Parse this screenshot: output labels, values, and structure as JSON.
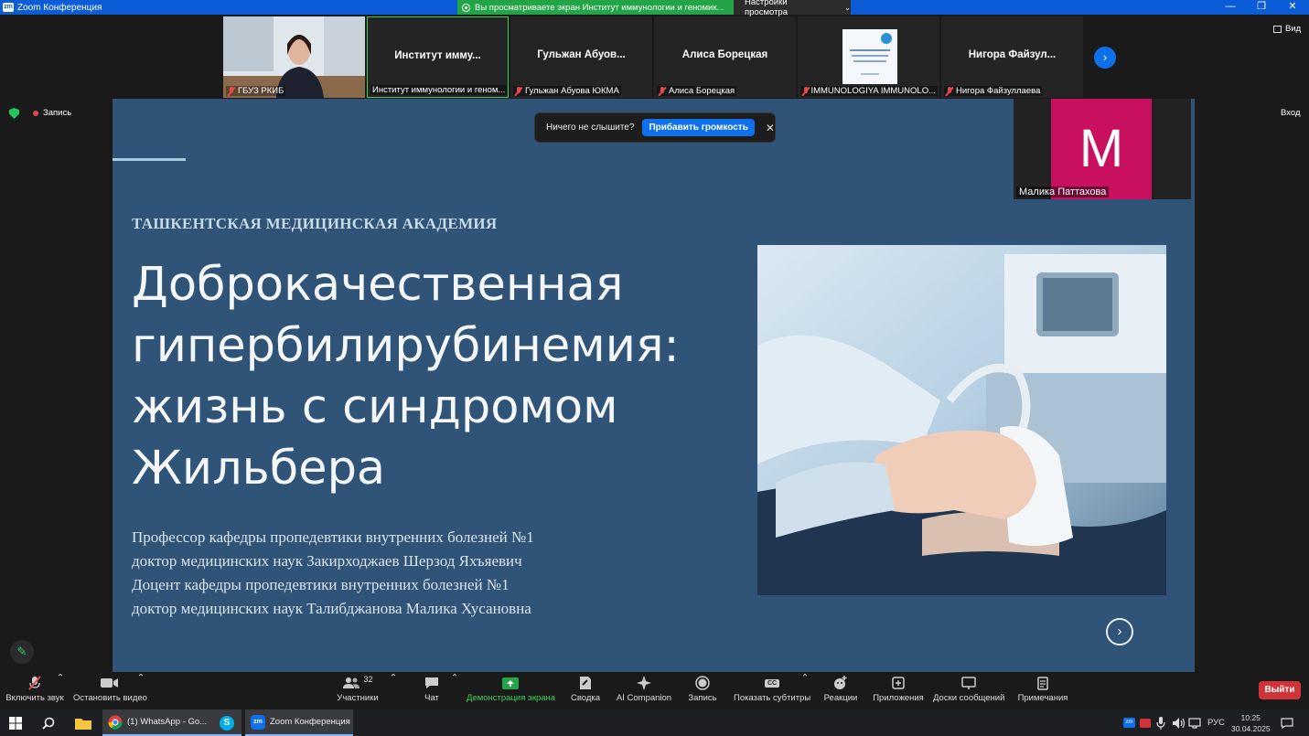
{
  "window": {
    "app_icon": "zm",
    "title": "Zoom Конференция",
    "share_banner": "Вы просматриваете экран Институт иммунологии и геномик...",
    "view_settings": "Настройки просмотра"
  },
  "strip": {
    "tiles": [
      {
        "name": "",
        "caption": "ГБУЗ РКИБ",
        "type": "video",
        "muted": true
      },
      {
        "name": "Институт  имму...",
        "caption": "Институт иммунологии и геном...",
        "muted": false
      },
      {
        "name": "Гульжан  Абуов...",
        "caption": "Гульжан Абуова ЮКМА",
        "muted": true
      },
      {
        "name": "Алиса Борецкая",
        "caption": "Алиса Борецкая",
        "muted": true
      },
      {
        "name": "",
        "caption": "IMMUNOLOGIYA IMMUNOLO...",
        "type": "logo",
        "muted": true
      },
      {
        "name": "Нигора  Файзул...",
        "caption": "Нигора Файзуллаева",
        "muted": true
      }
    ],
    "view_label": "Вид"
  },
  "status": {
    "recording": "Запись",
    "vhod": "Вход"
  },
  "toast": {
    "message": "Ничего не слышите?",
    "button": "Прибавить громкость"
  },
  "slide": {
    "academy": "ТАШКЕНТСКАЯ МЕДИЦИНСКАЯ АКАДЕМИЯ",
    "title_lines": [
      "Доброкачественная",
      "гипербилирубинемия:",
      "жизнь с синдромом",
      "Жильбера"
    ],
    "authors": [
      " Профессор кафедры пропедевтики внутренних болезней №1",
      "доктор медицинских наук Закирходжаев Шерзод Яхъяевич",
      "Доцент кафедры пропедевтики внутренних болезней №1",
      "доктор медицинских наук Талибджанова Малика Хусановна"
    ]
  },
  "floating": {
    "initial": "M",
    "name": "Малика Паттахова",
    "avatar_color": "#c8105f"
  },
  "toolbar": {
    "unmute": "Включить звук",
    "stop_video": "Остановить видео",
    "participants": "Участники",
    "participants_count": "32",
    "chat": "Чат",
    "share": "Демонстрация экрана",
    "summary": "Сводка",
    "ai": "AI Companion",
    "record": "Запись",
    "captions": "Показать субтитры",
    "reactions": "Реакции",
    "apps": "Приложения",
    "whiteboards": "Доски сообщений",
    "notes": "Примечания",
    "leave": "Выйти",
    "cc": "CC"
  },
  "taskbar": {
    "whatsapp": "(1) WhatsApp - Go...",
    "zoom": "Zoom Конференция",
    "lang": "РУС",
    "time": "10:25",
    "date": "30.04.2025"
  },
  "colors": {
    "zoom_blue": "#0e71eb",
    "share_green": "#23a547",
    "slide_bg": "#305477",
    "leave_red": "#d13438"
  }
}
